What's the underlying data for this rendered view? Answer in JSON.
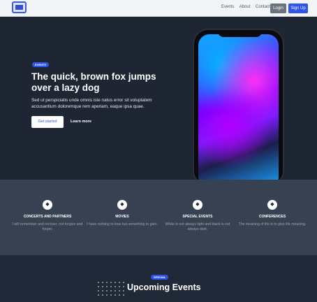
{
  "nav": {
    "links": [
      "Events",
      "About",
      "Contact"
    ],
    "login_label": "Login",
    "signup_label": "Sign Up"
  },
  "hero": {
    "badge": "EVENTS",
    "title": "The quick, brown fox jumps over a lazy dog",
    "description": "Sed ut perspiciatis unde omnis iste natus error sit voluptatem accusantium doloremque rem aperiam, eaque ipsa quae.",
    "primary_cta": "Get started",
    "secondary_cta": "Learn more"
  },
  "features": [
    {
      "icon": "diamond-icon",
      "title": "CONCERTS AND PARTNERS",
      "text": "I will remember and recover, not forgive and forget."
    },
    {
      "icon": "diamond-icon",
      "title": "MOVIES",
      "text": "I have nothing to lose but something to gain."
    },
    {
      "icon": "diamond-icon",
      "title": "SPECIAL EVENTS",
      "text": "White is not always light and black is not always dark."
    },
    {
      "icon": "diamond-icon",
      "title": "CONFERENCES",
      "text": "The meaning of life is to give life meaning."
    }
  ],
  "upcoming": {
    "badge": "SPECIAL",
    "title": "Upcoming Events"
  },
  "colors": {
    "accent": "#2f54eb",
    "dark_bg": "#1f2937",
    "section_bg": "#384152"
  }
}
